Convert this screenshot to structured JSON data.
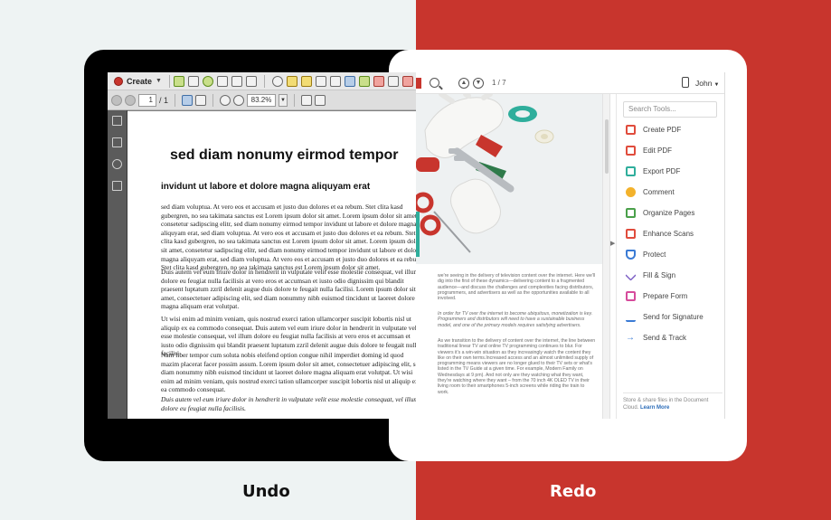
{
  "captions": {
    "undo": "Undo",
    "redo": "Redo"
  },
  "colors": {
    "left_bg": "#eef3f3",
    "right_bg": "#c8352d",
    "link": "#2d6db9"
  },
  "old_ui": {
    "create_label": "Create",
    "page_current": "1",
    "page_total": "/ 1",
    "zoom": "83.2%",
    "doc": {
      "heading": "sed diam nonumy eirmod tempor",
      "subheading": "invidunt ut labore et dolore magna aliquyam erat",
      "paragraphs": [
        "sed diam voluptua. At vero eos et accusam et justo duo dolores et ea rebum. Stet clita kasd gubergren, no sea takimata sanctus est Lorem ipsum dolor sit amet. Lorem ipsum dolor sit amet, consetetur sadipscing elitr, sed diam nonumy eirmod tempor invidunt ut labore et dolore magna aliquyam erat, sed diam voluptua. At vero eos et accusam et justo duo dolores et ea rebum. Stet clita kasd gubergren, no sea takimata sanctus est Lorem ipsum dolor sit amet. Lorem ipsum dolor sit amet, consetetur sadipscing elitr, sed diam nonumy eirmod tempor invidunt ut labore et dolore magna aliquyam erat, sed diam voluptua. At vero eos et accusam et justo duo dolores et ea rebum. Stet clita kasd gubergren, no sea takimata sanctus est Lorem ipsum dolor sit amet.",
        "Duis autem vel eum iriure dolor in hendrerit in vulputate velit esse molestie consequat, vel illum dolore eu feugiat nulla facilisis at vero eros et accumsan et iusto odio dignissim qui blandit praesent luptatum zzril delenit augue duis dolore te feugait nulla facilisi. Lorem ipsum dolor sit amet, consectetuer adipiscing elit, sed diam nonummy nibh euismod tincidunt ut laoreet dolore magna aliquam erat volutpat.",
        "Ut wisi enim ad minim veniam, quis nostrud exerci tation ullamcorper suscipit lobortis nisl ut aliquip ex ea commodo consequat. Duis autem vel eum iriure dolor in hendrerit in vulputate velit esse molestie consequat, vel illum dolore eu feugiat nulla facilisis at vero eros et accumsan et iusto odio dignissim qui blandit praesent luptatum zzril delenit augue duis dolore te feugait nulla facilisi.",
        "Nam liber tempor cum soluta nobis eleifend option congue nihil imperdiet doming id quod mazim placerat facer possim assum. Lorem ipsum dolor sit amet, consectetuer adipiscing elit, sed diam nonummy nibh euismod tincidunt ut laoreet dolore magna aliquam erat volutpat. Ut wisi enim ad minim veniam, quis nostrud exerci tation ullamcorper suscipit lobortis nisl ut aliquip ex ea commodo consequat.",
        "Duis autem vel eum iriure dolor in hendrerit in vulputate velit esse molestie consequat, vel illum dolore eu feugiat nulla facilisis."
      ]
    }
  },
  "new_ui": {
    "page_indicator": "1 / 7",
    "user": "John",
    "search_placeholder": "Search Tools...",
    "tools": [
      {
        "label": "Create PDF",
        "icon": "create-pdf-icon",
        "color": "#e04c3c"
      },
      {
        "label": "Edit PDF",
        "icon": "edit-pdf-icon",
        "color": "#e04c3c"
      },
      {
        "label": "Export PDF",
        "icon": "export-pdf-icon",
        "color": "#2fae9c"
      },
      {
        "label": "Comment",
        "icon": "comment-icon",
        "color": "#f3b22c"
      },
      {
        "label": "Organize Pages",
        "icon": "organize-pages-icon",
        "color": "#4aa04a"
      },
      {
        "label": "Enhance Scans",
        "icon": "enhance-scans-icon",
        "color": "#e04c3c"
      },
      {
        "label": "Protect",
        "icon": "protect-icon",
        "color": "#3a7bd5"
      },
      {
        "label": "Fill & Sign",
        "icon": "fill-sign-icon",
        "color": "#7a5cc4"
      },
      {
        "label": "Prepare Form",
        "icon": "prepare-form-icon",
        "color": "#d64b9c"
      },
      {
        "label": "Send for Signature",
        "icon": "send-signature-icon",
        "color": "#3a7bd5"
      },
      {
        "label": "Send & Track",
        "icon": "send-track-icon",
        "color": "#3a7bd5"
      }
    ],
    "footer_text": "Store & share files in the Document Cloud.",
    "footer_link": "Learn More",
    "doc_paragraphs": [
      "we're seeing in the delivery of television content over the internet. Here we'll dig into the first of these dynamics—delivering content to a fragmented audience—and discuss the challenges and complexities facing distributors, programmers, and advertisers as well as the opportunities available to all involved.",
      "In order for TV over the internet to become ubiquitous, monetization is key. Programmers and distributors will need to have a sustainable business model, and one of the primary models requires satisfying advertisers.",
      "As we transition to the delivery of content over the internet, the line between traditional linear TV and online TV programming continues to blur. For viewers it's a win-win situation as they increasingly watch the content they like on their own terms.Increased access and an almost unlimited supply of programming means viewers are no longer glued to their TV sets or what's listed in the TV Guide at a given time. For example, Modern Family on Wednesdays at 9 pm). And not only are they watching what they want, they're watching where they want – from the 70 inch 4K OLED TV in their living room to their smartphones 5-inch screens while riding the train to work."
    ]
  }
}
